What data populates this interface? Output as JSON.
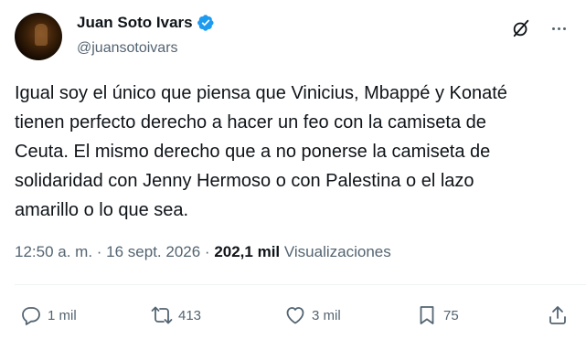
{
  "author": {
    "name": "Juan Soto Ivars",
    "handle": "@juansotoivars",
    "verified": true
  },
  "tweet": {
    "text": "Igual soy el único que piensa que Vinicius, Mbappé y Konaté\ntienen perfecto derecho a hacer un feo con la camiseta de\nCeuta. El mismo derecho que a no ponerse la camiseta de\nsolidaridad con Jenny Hermoso o con Palestina o el lazo\namarillo o lo que sea.",
    "time": "12:50 a. m.",
    "separator": " · ",
    "date": "16 sept. 2026",
    "views_count": "202,1 mil",
    "views_label": "Visualizaciones"
  },
  "actions": {
    "replies": "1 mil",
    "reposts": "413",
    "likes": "3 mil",
    "bookmarks": "75"
  },
  "colors": {
    "text": "#0f1419",
    "secondary": "#536471",
    "verified": "#1d9bf0"
  },
  "icons": [
    "verified-badge-icon",
    "grok-icon",
    "more-icon",
    "reply-icon",
    "repost-icon",
    "like-icon",
    "bookmark-icon",
    "share-icon"
  ]
}
